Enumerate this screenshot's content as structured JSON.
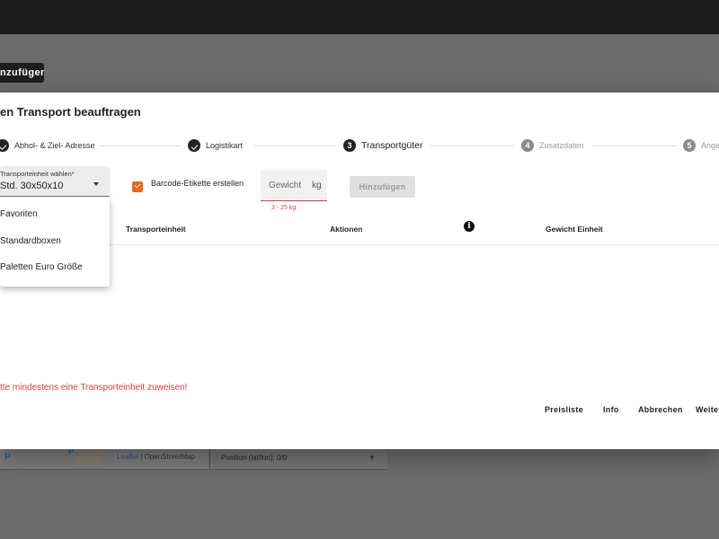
{
  "background": {
    "add_button_label": "nzufügen",
    "map_attribution_leaflet": "Leaflet",
    "map_attribution_osm": "| OpenStreetMap",
    "map_poi_letter": "P",
    "position_label": "Position (lat/lon): 0/0"
  },
  "dialog": {
    "title": "en Transport beauftragen",
    "steps": [
      {
        "number": "1",
        "label": "Abhol- & Ziel- Adresse",
        "state": "done"
      },
      {
        "number": "2",
        "label": "Logistikart",
        "state": "done"
      },
      {
        "number": "3",
        "label": "Transportgüter",
        "state": "active"
      },
      {
        "number": "4",
        "label": "Zusatzdaten",
        "state": "inactive"
      },
      {
        "number": "5",
        "label": "Ange",
        "state": "inactive"
      }
    ],
    "transport_unit_select": {
      "label": "Transporteinheit wählen*",
      "value": "Std. 30x50x10",
      "options": [
        "Favoriten",
        "Standardboxen",
        "Paletten Euro Größe"
      ]
    },
    "barcode_checkbox": {
      "label": "Barcode-Etikette erstellen",
      "checked": true
    },
    "weight_input": {
      "placeholder": "Gewicht",
      "unit": "kg",
      "hint": "3 - 25 kg"
    },
    "add_button_label": "Hinzufügen",
    "table_headers": {
      "unit": "Transporteinheit",
      "actions": "Aktionen",
      "info": "i",
      "weight": "Gewicht Einheit"
    },
    "error_message": "tte mindestens eine Transporteinheit zuweisen!",
    "footer": {
      "price_list": "Preisliste",
      "info": "Info",
      "cancel": "Abbrechen",
      "next": "Weite"
    }
  },
  "colors": {
    "accent": "#e8671a",
    "error": "#e53935",
    "overlay": "#6b6b6b",
    "topbar": "#1b1b1b"
  }
}
